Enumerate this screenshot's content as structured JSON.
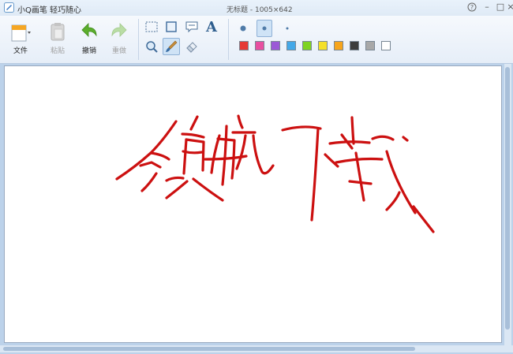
{
  "window": {
    "app_title": "小Q画笔 轻巧随心",
    "doc_title": "无标题 - 1005×642",
    "controls": [
      "?",
      "–",
      "□",
      "×"
    ]
  },
  "toolbar": {
    "file": "文件",
    "paste": "粘贴",
    "undo": "撤销",
    "redo": "重做"
  },
  "tools": [
    "select-rect-icon",
    "crop-icon",
    "speech-bubble-icon",
    "text-icon",
    "zoom-icon",
    "brush-icon",
    "eraser-icon"
  ],
  "active_tool": "brush",
  "brush_sizes": [
    "large",
    "medium",
    "small"
  ],
  "active_brush_size": "medium",
  "palette": [
    "#e53935",
    "#e84fa0",
    "#9b59d6",
    "#44a8e8",
    "#7ed321",
    "#f5e02a",
    "#f7a51c",
    "#3c3c3c",
    "#a8a8a8",
    "#ffffff"
  ],
  "ink_color": "#cc1010",
  "canvas": {
    "sketch_text": "领航下载"
  }
}
